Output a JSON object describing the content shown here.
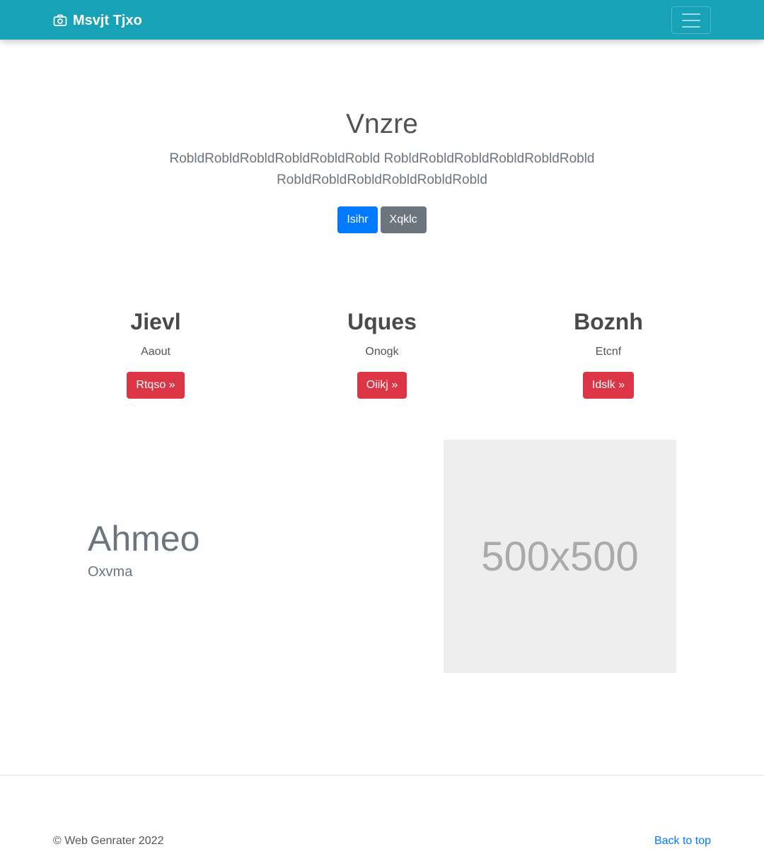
{
  "navbar": {
    "brand_icon": "camera-icon",
    "brand": "Msvjt Tjxo",
    "toggler_icon": "hamburger-menu-icon",
    "color": "#17a2b8"
  },
  "hero": {
    "title": "Vnzre",
    "lead": "RobldRobldRobldRobldRobldRobld RobldRobldRobldRobldRobldRobld RobldRobldRobldRobldRobldRobld",
    "primary_button": "Isihr",
    "secondary_button": "Xqklc"
  },
  "features": [
    {
      "title": "Jievl",
      "text": "Aaout",
      "button": "Rtqso »"
    },
    {
      "title": "Uques",
      "text": "Onogk",
      "button": "Oiikj »"
    },
    {
      "title": "Boznh",
      "text": "Etcnf",
      "button": "Idslk »"
    }
  ],
  "featurette": {
    "heading": "Ahmeo",
    "subheading": "Oxvma",
    "image_label": "500x500"
  },
  "footer": {
    "copyright": "© Web Genrater 2022",
    "back_to_top": "Back to top"
  },
  "colors": {
    "primary": "#007bff",
    "secondary": "#6c757d",
    "danger": "#dc3545"
  }
}
